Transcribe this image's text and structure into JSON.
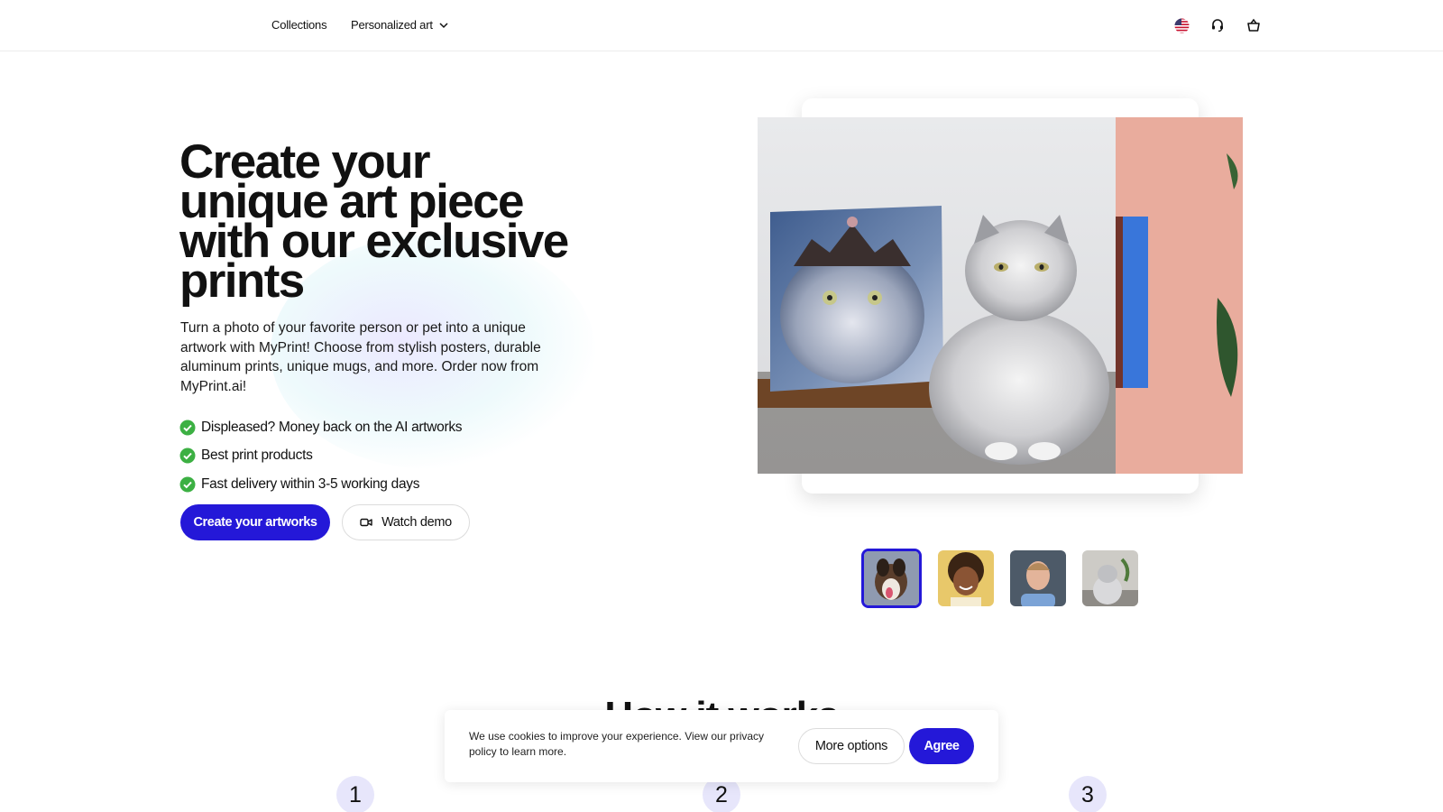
{
  "nav": {
    "links": [
      {
        "label": "Collections"
      },
      {
        "label": "Personalized art"
      }
    ],
    "icons": [
      "us-flag-icon",
      "headset-icon",
      "basket-icon"
    ]
  },
  "hero": {
    "title": "Create your unique art piece with our exclusive prints",
    "description": "Turn a photo of your favorite person or pet into a unique artwork with MyPrint! Choose from stylish posters, durable aluminum prints, unique mugs, and more. Order now from MyPrint.ai!",
    "features": [
      "Displeased? Money back on the AI artworks",
      "Best print products",
      "Fast delivery within 3-5 working days"
    ],
    "primary_button": "Create your artworks",
    "secondary_button": "Watch demo",
    "thumbnails": [
      "dog",
      "child",
      "man",
      "cat"
    ],
    "active_thumbnail": "dog"
  },
  "how_it_works": {
    "title": "How it works",
    "steps": [
      "1",
      "2",
      "3"
    ]
  },
  "cookie": {
    "text": "We use cookies to improve your experience. View our privacy policy to learn more.",
    "more_options": "More options",
    "agree": "Agree"
  },
  "colors": {
    "accent": "#2418d8",
    "check_green": "#3cb043",
    "step_bg": "#e7e6fb"
  }
}
